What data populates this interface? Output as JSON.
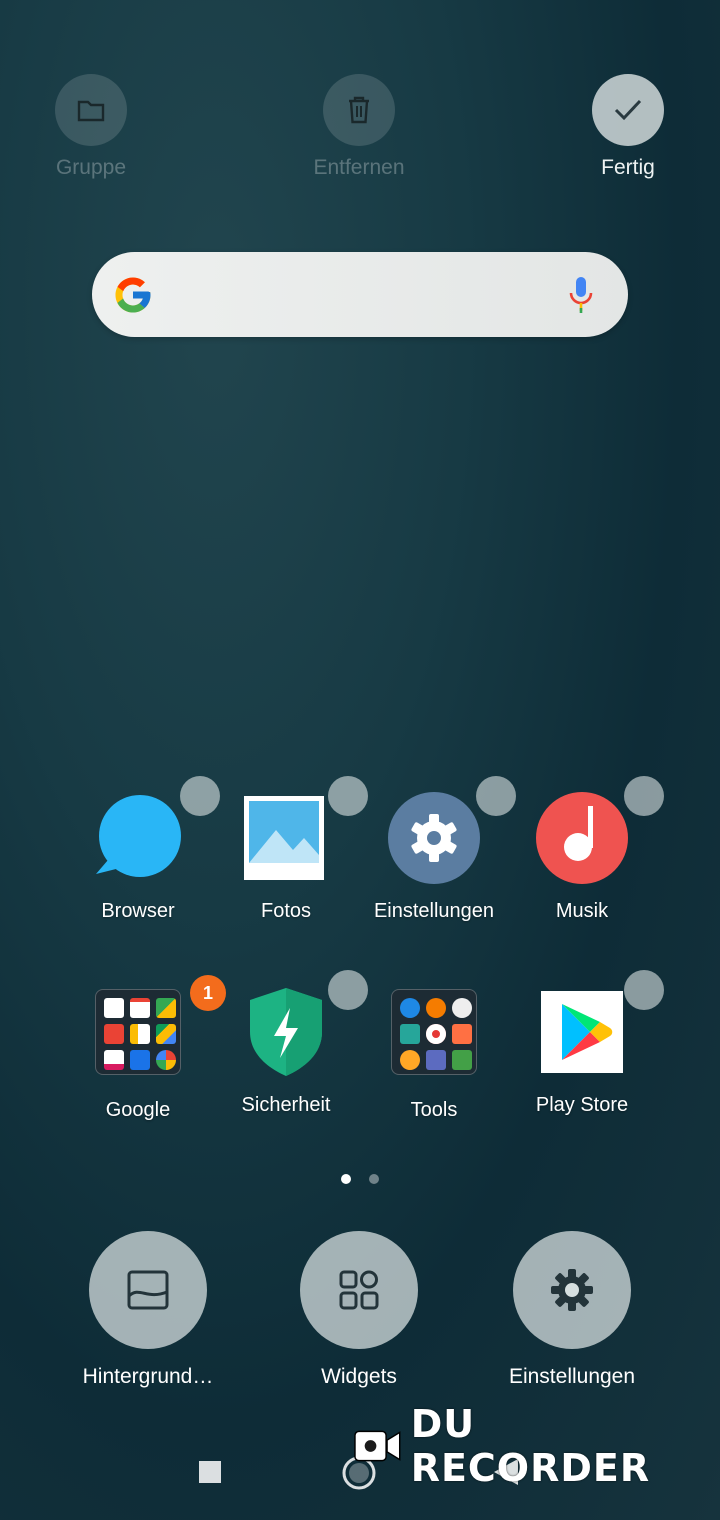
{
  "top_actions": {
    "group_label": "Gruppe",
    "remove_label": "Entfernen",
    "done_label": "Fertig"
  },
  "search": {
    "icons": [
      "google-g-icon",
      "microphone-icon"
    ]
  },
  "apps": [
    {
      "label": "Browser"
    },
    {
      "label": "Fotos"
    },
    {
      "label": "Einstellungen"
    },
    {
      "label": "Musik"
    },
    {
      "label": "Google",
      "badge": "1"
    },
    {
      "label": "Sicherheit"
    },
    {
      "label": "Tools"
    },
    {
      "label": "Play Store"
    }
  ],
  "page_indicator": {
    "pages": 2,
    "current": 1
  },
  "edit_options": [
    {
      "label": "Hintergrund…",
      "icon": "wallpaper-icon"
    },
    {
      "label": "Widgets",
      "icon": "widgets-icon"
    },
    {
      "label": "Einstellungen",
      "icon": "gear-icon"
    }
  ],
  "nav": {
    "icons": [
      "recents-icon",
      "home-icon",
      "back-icon"
    ]
  },
  "watermark": {
    "text": "DU RECORDER"
  },
  "colors": {
    "badge": "#f36c1c",
    "browser": "#29b6f6",
    "music": "#ef5350",
    "security": "#1db383"
  }
}
